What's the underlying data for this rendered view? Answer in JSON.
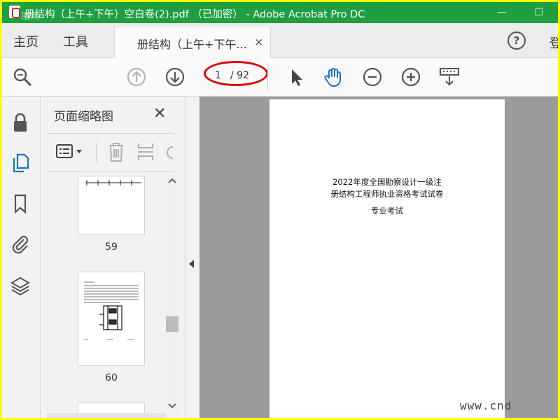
{
  "window": {
    "title": "册结构（上午+下午）空白卷(2).pdf （已加密） - Adobe Acrobat Pro DC",
    "logo_text": "圈网",
    "minimize_glyph": "—",
    "maximize_glyph": "☐",
    "app_icon": "acrobat-icon"
  },
  "menu": {
    "home": "主页",
    "tools": "工具",
    "doc_tab_label": "册结构（上午+下午...",
    "doc_tab_close": "×",
    "help": "?",
    "signin_partial": "登"
  },
  "toolbar": {
    "current_page": "1",
    "total_pages": "/ 92",
    "icons": [
      "search-zoom-icon",
      "page-up-icon",
      "page-down-icon",
      "select-arrow-icon",
      "hand-tool-icon",
      "zoom-out-icon",
      "zoom-in-icon",
      "keyboard-icon"
    ]
  },
  "rail": {
    "icons": [
      "lock-icon",
      "pages-icon",
      "bookmark-icon",
      "attachment-icon",
      "layers-icon"
    ]
  },
  "thumbnails_panel": {
    "title": "页面缩略图",
    "close": "✕",
    "pages": [
      {
        "number": "59"
      },
      {
        "number": "60"
      }
    ]
  },
  "document": {
    "line1": "2022年度全国勘察设计一级注",
    "line2": "册结构工程师执业资格考试试卷",
    "line3": "专业考试",
    "watermark": "www.cnd"
  },
  "colors": {
    "titlebar": "#1f9f3f",
    "border": "#ffff00",
    "annotation": "#e00000",
    "accent_blue": "#1a73c8"
  }
}
